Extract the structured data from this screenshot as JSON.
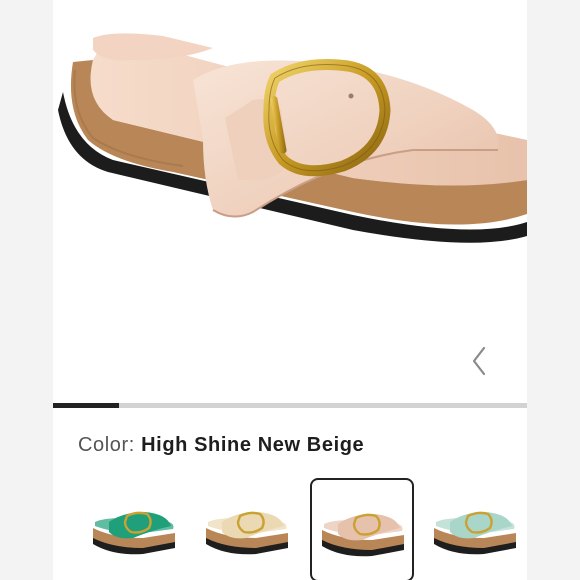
{
  "product": {
    "color_label": "Color:",
    "color_value": "High Shine New Beige",
    "image_icon": "sandal-product-image"
  },
  "gallery": {
    "progress": 0.14,
    "prev_icon": "chevron-left-icon"
  },
  "swatches": [
    {
      "name": "green",
      "color": "#1fa07a",
      "selected": false
    },
    {
      "name": "cream",
      "color": "#ead9b2",
      "selected": false
    },
    {
      "name": "high-shine-new-beige",
      "color": "#e6c2ad",
      "selected": true
    },
    {
      "name": "mint",
      "color": "#a9d6c8",
      "selected": false
    }
  ],
  "colors": {
    "strap": "#f0d5c4",
    "cork": "#b9895a",
    "buckle": "#c9a233",
    "sole": "#1e1e1e"
  }
}
